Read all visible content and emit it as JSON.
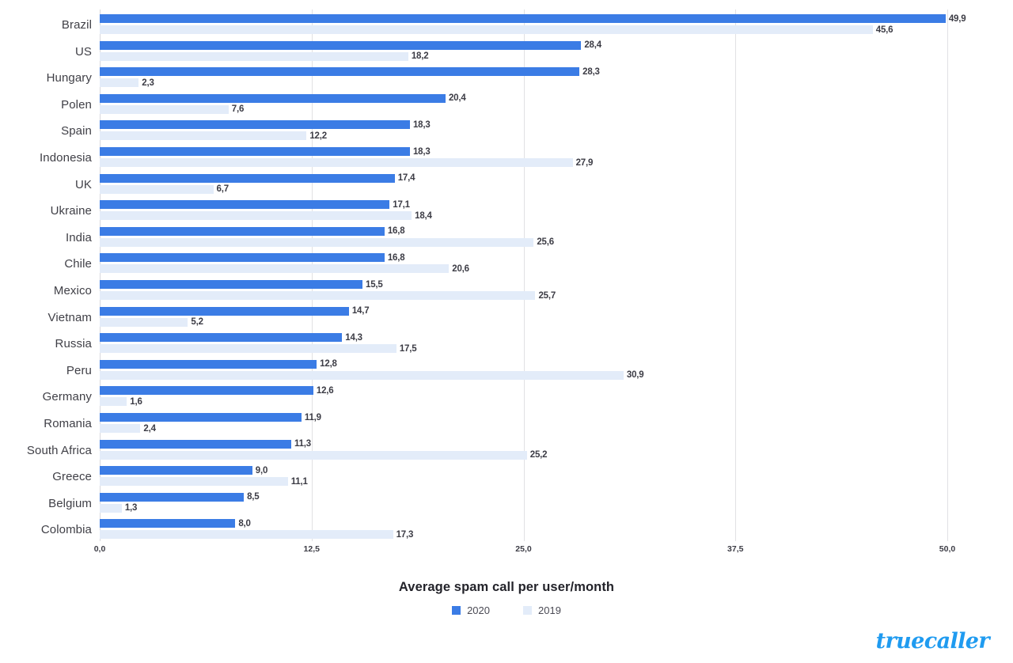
{
  "chart_data": {
    "type": "bar",
    "orientation": "horizontal",
    "title": "Average spam call per user/month",
    "xlabel": "",
    "ylabel": "",
    "xlim": [
      0.0,
      50.0
    ],
    "xticks": [
      "0,0",
      "12,5",
      "25,0",
      "37,5",
      "50,0"
    ],
    "xtick_values": [
      0.0,
      12.5,
      25.0,
      37.5,
      50.0
    ],
    "grid": true,
    "legend_position": "bottom",
    "decimal_separator": ",",
    "categories": [
      "Brazil",
      "US",
      "Hungary",
      "Polen",
      "Spain",
      "Indonesia",
      "UK",
      "Ukraine",
      "India",
      "Chile",
      "Mexico",
      "Vietnam",
      "Russia",
      "Peru",
      "Germany",
      "Romania",
      "South Africa",
      "Greece",
      "Belgium",
      "Colombia"
    ],
    "series": [
      {
        "name": "2020",
        "color": "#3b7ce5",
        "values": [
          49.9,
          28.4,
          28.3,
          20.4,
          18.3,
          18.3,
          17.4,
          17.1,
          16.8,
          16.8,
          15.5,
          14.7,
          14.3,
          12.8,
          12.6,
          11.9,
          11.3,
          9.0,
          8.5,
          8.0
        ],
        "labels": [
          "49,9",
          "28,4",
          "28,3",
          "20,4",
          "18,3",
          "18,3",
          "17,4",
          "17,1",
          "16,8",
          "16,8",
          "15,5",
          "14,7",
          "14,3",
          "12,8",
          "12,6",
          "11,9",
          "11,3",
          "9,0",
          "8,5",
          "8,0"
        ]
      },
      {
        "name": "2019",
        "color": "#e3ecf9",
        "values": [
          45.6,
          18.2,
          2.3,
          7.6,
          12.2,
          27.9,
          6.7,
          18.4,
          25.6,
          20.6,
          25.7,
          5.2,
          17.5,
          30.9,
          1.6,
          2.4,
          25.2,
          11.1,
          1.3,
          17.3
        ],
        "labels": [
          "45,6",
          "18,2",
          "2,3",
          "7,6",
          "12,2",
          "27,9",
          "6,7",
          "18,4",
          "25,6",
          "20,6",
          "25,7",
          "5,2",
          "17,5",
          "30,9",
          "1,6",
          "2,4",
          "25,2",
          "11,1",
          "1,3",
          "17,3"
        ]
      }
    ]
  },
  "legend": {
    "items": [
      {
        "label": "2020",
        "color": "#3b7ce5"
      },
      {
        "label": "2019",
        "color": "#e3ecf9"
      }
    ]
  },
  "brand": {
    "name": "truecaller",
    "part_one": "true",
    "part_two": "caller",
    "color": "#1f9bf0"
  },
  "colors": {
    "series_2020": "#3b7ce5",
    "series_2019": "#e3ecf9",
    "grid": "#e1e1e4",
    "text": "#3c3c45",
    "background": "#ffffff"
  }
}
